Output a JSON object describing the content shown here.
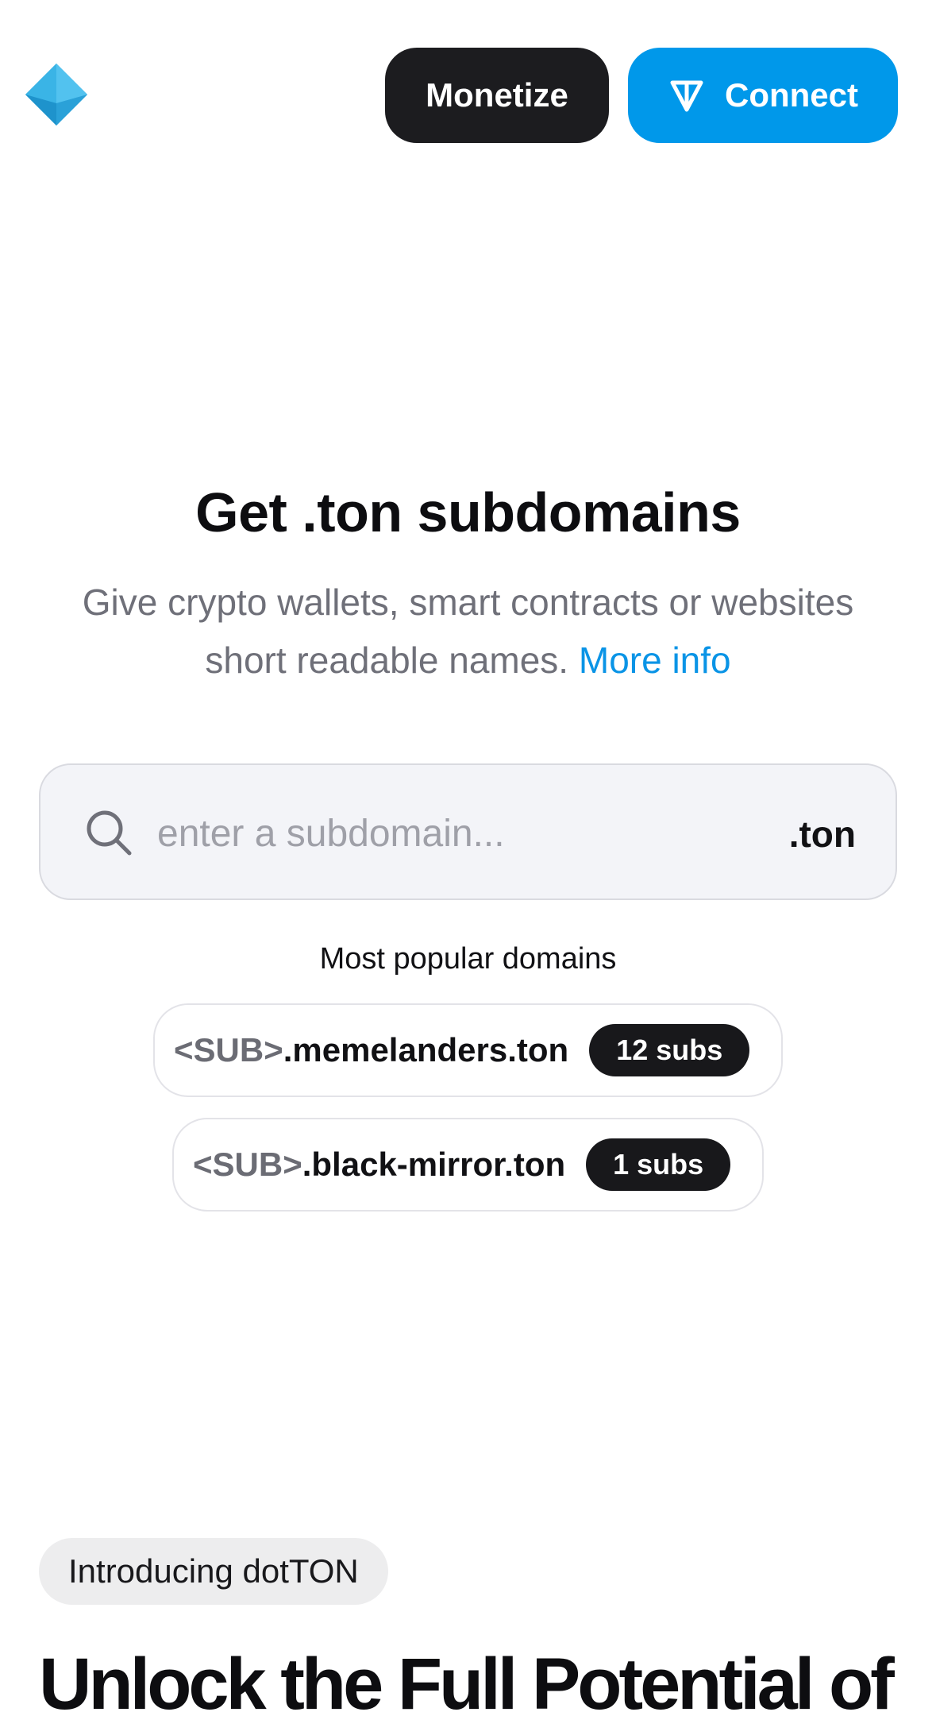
{
  "header": {
    "logo_icon": "diamond-logo-icon",
    "monetize_label": "Monetize",
    "connect_label": "Connect",
    "connect_icon": "ton-icon"
  },
  "hero": {
    "title": "Get .ton subdomains",
    "subtitle": "Give crypto wallets, smart contracts or websites short readable names.",
    "more_info_label": "More info"
  },
  "search": {
    "placeholder": "enter a subdomain...",
    "value": "",
    "suffix": ".ton",
    "icon": "search-icon"
  },
  "popular": {
    "label": "Most popular domains",
    "domains": [
      {
        "prefix": "<SUB>",
        "name": ".memelanders.ton",
        "subs": "12 subs"
      },
      {
        "prefix": "<SUB>",
        "name": ".black-mirror.ton",
        "subs": "1 subs"
      }
    ]
  },
  "intro": {
    "badge": "Introducing dotTON",
    "title": "Unlock the Full Potential of"
  },
  "colors": {
    "accent": "#0098ea",
    "dark_button": "#1c1c1f",
    "link": "#0a94e6",
    "muted_text": "#6f7079"
  }
}
